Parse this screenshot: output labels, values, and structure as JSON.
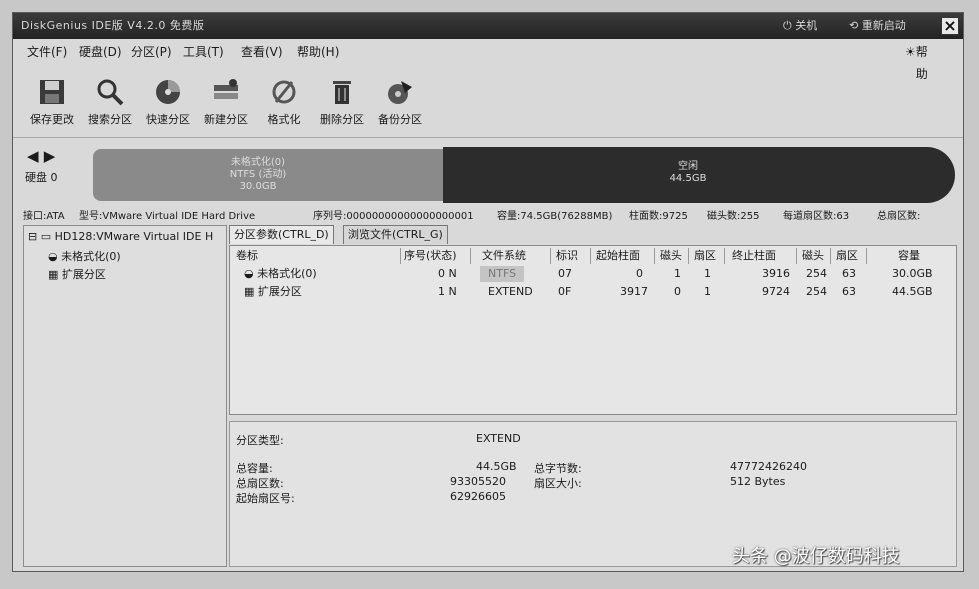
{
  "window": {
    "title": "DiskGenius IDE版 V4.2.0 免费版",
    "title_buttons": [
      "关机",
      "重新启动"
    ],
    "help_label": "帮助"
  },
  "menu": [
    "文件(F)",
    "硬盘(D)",
    "分区(P)",
    "工具(T)",
    "查看(V)",
    "帮助(H)"
  ],
  "toolbar": [
    {
      "label": "保存更改",
      "icon": "save-icon"
    },
    {
      "label": "搜索分区",
      "icon": "search-icon"
    },
    {
      "label": "快速分区",
      "icon": "quick-partition-icon"
    },
    {
      "label": "新建分区",
      "icon": "new-partition-icon"
    },
    {
      "label": "格式化",
      "icon": "format-icon"
    },
    {
      "label": "删除分区",
      "icon": "delete-icon"
    },
    {
      "label": "备份分区",
      "icon": "backup-icon"
    }
  ],
  "disk_map": {
    "disk_label": "硬盘 0",
    "seg1_lines": [
      "未格式化(0)",
      "NTFS (活动)",
      "30.0GB"
    ],
    "seg2_lines": [
      "空闲",
      "44.5GB"
    ]
  },
  "disk_info": {
    "interface": "接口:ATA",
    "model": "型号:VMware Virtual IDE Hard Drive",
    "serial": "序列号:00000000000000000001",
    "capacity": "容量:74.5GB(76288MB)",
    "cylinders": "柱面数:9725",
    "heads": "磁头数:255",
    "sectors_per_track": "每道扇区数:63",
    "total_sectors": "总扇区数:"
  },
  "tree": {
    "root": "HD128:VMware Virtual IDE H",
    "children": [
      "未格式化(0)",
      "扩展分区"
    ]
  },
  "tabs": [
    "分区参数(CTRL_D)",
    "浏览文件(CTRL_G)"
  ],
  "table": {
    "headers": [
      "卷标",
      "序号(状态)",
      "文件系统",
      "标识",
      "起始柱面",
      "磁头",
      "扇区",
      "终止柱面",
      "磁头",
      "扇区",
      "容量"
    ],
    "rows": [
      [
        "未格式化(0)",
        "0 N",
        "NTFS",
        "07",
        "0",
        "1",
        "1",
        "3916",
        "254",
        "63",
        "30.0GB"
      ],
      [
        "扩展分区",
        "1 N",
        "EXTEND",
        "0F",
        "3917",
        "0",
        "1",
        "9724",
        "254",
        "63",
        "44.5GB"
      ]
    ]
  },
  "details": {
    "type_label": "分区类型:",
    "type_value": "EXTEND",
    "total_cap_label": "总容量:",
    "total_cap_value": "44.5GB",
    "total_bytes_label": "总字节数:",
    "total_bytes_value": "47772426240",
    "total_sectors_label": "总扇区数:",
    "total_sectors_value": "93305520",
    "sector_size_label": "扇区大小:",
    "sector_size_value": "512 Bytes",
    "start_sector_label": "起始扇区号:",
    "start_sector_value": "62926605"
  },
  "watermark": "头条 @波仔数码科技"
}
